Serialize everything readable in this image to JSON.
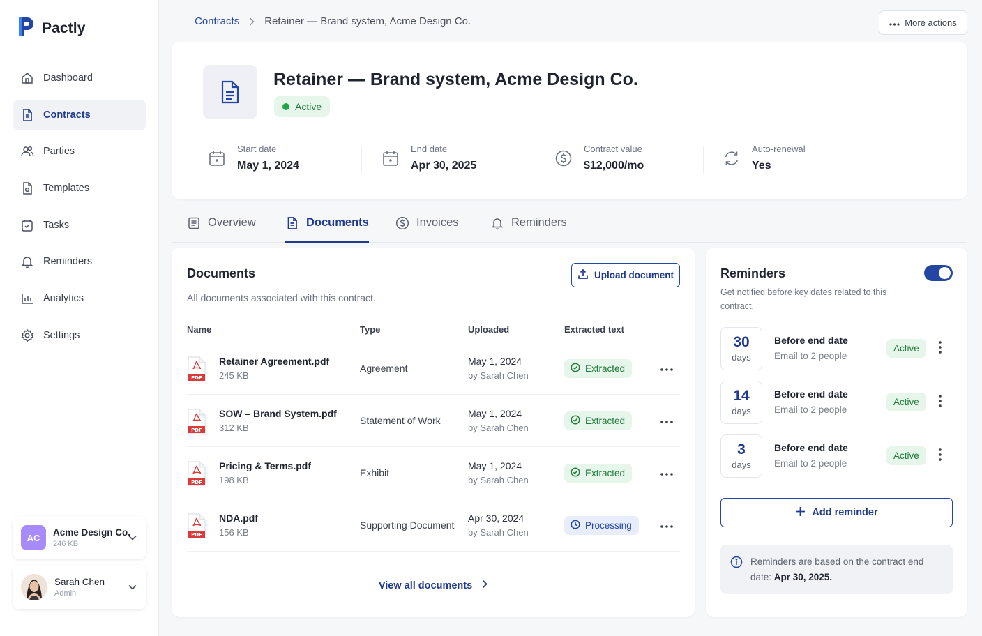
{
  "app": {
    "name": "Pactly"
  },
  "sidebar": {
    "items": [
      {
        "label": "Dashboard",
        "icon": "dashboard-icon"
      },
      {
        "label": "Contracts",
        "icon": "contract-icon",
        "active": true
      },
      {
        "label": "Parties",
        "icon": "users-icon"
      },
      {
        "label": "Templates",
        "icon": "template-icon"
      },
      {
        "label": "Tasks",
        "icon": "tasks-icon"
      },
      {
        "label": "Reminders",
        "icon": "bell-icon"
      },
      {
        "label": "Analytics",
        "icon": "analytics-icon"
      },
      {
        "label": "Settings",
        "icon": "gear-icon"
      }
    ],
    "account": {
      "initials": "AC",
      "name": "Acme Design Co.",
      "sub": "246 KB"
    },
    "user": {
      "name": "Sarah Chen",
      "role": "Admin"
    }
  },
  "breadcrumb": {
    "parent": "Contracts",
    "current": "Retainer — Brand system, Acme Design Co."
  },
  "more_actions_label": "More actions",
  "contract": {
    "title": "Retainer — Brand system, Acme Design Co.",
    "status": "Active",
    "meta": [
      {
        "label": "Start date",
        "value": "May 1, 2024",
        "icon": "calendar-icon"
      },
      {
        "label": "End date",
        "value": "Apr 30, 2025",
        "icon": "calendar-icon"
      },
      {
        "label": "Contract value",
        "value": "$12,000/mo",
        "icon": "dollar-icon"
      },
      {
        "label": "Auto-renewal",
        "value": "Yes",
        "icon": "refresh-icon"
      }
    ]
  },
  "tabs": [
    {
      "label": "Overview",
      "icon": "overview-icon"
    },
    {
      "label": "Documents",
      "icon": "document-icon",
      "active": true
    },
    {
      "label": "Invoices",
      "icon": "dollar-icon"
    },
    {
      "label": "Reminders",
      "icon": "bell-icon"
    }
  ],
  "documents": {
    "title": "Documents",
    "description": "All documents associated with this contract.",
    "upload_label": "Upload document",
    "columns": [
      "Name",
      "Type",
      "Uploaded",
      "Extracted text"
    ],
    "rows": [
      {
        "name": "Retainer Agreement.pdf",
        "size": "245 KB",
        "type": "Agreement",
        "date": "May 1, 2024",
        "by": "by Sarah Chen",
        "status": "Extracted",
        "status_kind": "ok"
      },
      {
        "name": "SOW – Brand System.pdf",
        "size": "312 KB",
        "type": "Statement of Work",
        "date": "May 1, 2024",
        "by": "by Sarah Chen",
        "status": "Extracted",
        "status_kind": "ok"
      },
      {
        "name": "Pricing & Terms.pdf",
        "size": "198 KB",
        "type": "Exhibit",
        "date": "May 1, 2024",
        "by": "by Sarah Chen",
        "status": "Extracted",
        "status_kind": "ok"
      },
      {
        "name": "NDA.pdf",
        "size": "156 KB",
        "type": "Supporting Document",
        "date": "Apr 30, 2024",
        "by": "by Sarah Chen",
        "status": "Processing",
        "status_kind": "proc"
      }
    ],
    "file_badge": "PDF",
    "view_all_label": "View all documents"
  },
  "reminders": {
    "title": "Reminders",
    "description": "Get notified before key dates related to this contract.",
    "enabled": true,
    "items": [
      {
        "days": "30",
        "unit": "days",
        "title": "Before end date",
        "sub": "Email to 2 people",
        "status": "Active"
      },
      {
        "days": "14",
        "unit": "days",
        "title": "Before end date",
        "sub": "Email to 2 people",
        "status": "Active"
      },
      {
        "days": "3",
        "unit": "days",
        "title": "Before end date",
        "sub": "Email to 2 people",
        "status": "Active"
      }
    ],
    "add_label": "Add reminder",
    "info_prefix": "Reminders are based on the contract end date: ",
    "info_date": "Apr 30, 2025."
  },
  "colors": {
    "brand": "#1f3a8f",
    "success": "#1f7a3a",
    "success_bg": "#e7f6ea",
    "accent_purple": "#a78bfa"
  }
}
